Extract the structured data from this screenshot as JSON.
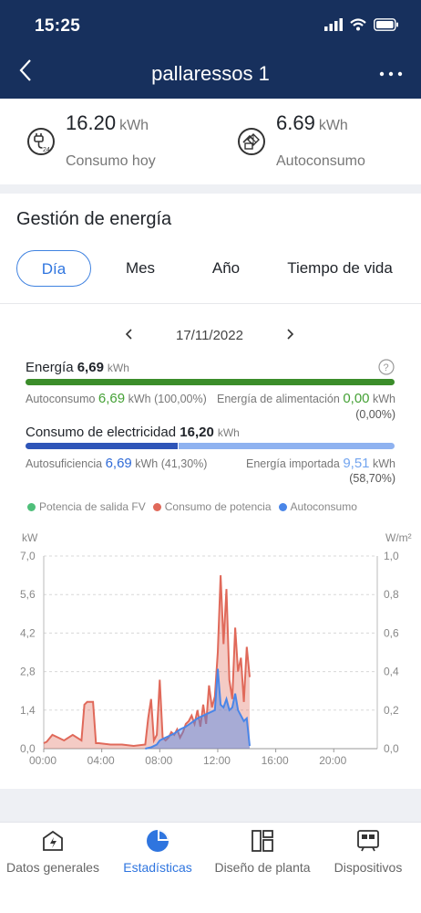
{
  "status_bar": {
    "time": "15:25"
  },
  "header": {
    "title": "pallaressos 1"
  },
  "summary": [
    {
      "icon": "plug-24h-icon",
      "value": "16.20",
      "unit": "kWh",
      "label": "Consumo hoy"
    },
    {
      "icon": "solar-home-icon",
      "value": "6.69",
      "unit": "kWh",
      "label": "Autoconsumo"
    }
  ],
  "panel": {
    "title": "Gestión de energía",
    "tabs": [
      "Día",
      "Mes",
      "Año",
      "Tiempo de vida"
    ],
    "active_tab": "Día",
    "date": "17/11/2022"
  },
  "energy": {
    "label": "Energía",
    "value": "6,69",
    "unit": "kWh",
    "autoconsumo_label": "Autoconsumo",
    "autoconsumo_value": "6,69",
    "autoconsumo_unit": "kWh",
    "autoconsumo_pct": "(100,00%)",
    "alimentacion_label": "Energía de alimentación",
    "alimentacion_value": "0,00",
    "alimentacion_unit": "kWh",
    "alimentacion_pct": "(0,00%)",
    "bar_fraction": 1.0,
    "bar_color": "#3b8d2a"
  },
  "consumo": {
    "label": "Consumo de electricidad",
    "value": "16,20",
    "unit": "kWh",
    "autosuficiencia_label": "Autosuficiencia",
    "autosuficiencia_value": "6,69",
    "autosuficiencia_unit": "kWh",
    "autosuficiencia_pct": "(41,30%)",
    "importada_label": "Energía importada",
    "importada_value": "9,51",
    "importada_unit": "kWh",
    "importada_pct": "(58,70%)",
    "bar_fraction": 0.413,
    "bar_color_left": "#2e55b8",
    "bar_color_right": "#8fb2f0"
  },
  "legend": [
    {
      "label": "Potencia de salida FV",
      "color": "#4fbf7a"
    },
    {
      "label": "Consumo de potencia",
      "color": "#e0695a"
    },
    {
      "label": "Autoconsumo",
      "color": "#4a86e8"
    }
  ],
  "chart_data": {
    "type": "area",
    "y_left_unit": "kW",
    "y_right_unit": "W/m²",
    "ylim": [
      0,
      7
    ],
    "y_left_ticks": [
      "0,0",
      "1,4",
      "2,8",
      "4,2",
      "5,6",
      "7,0"
    ],
    "y_right_ticks": [
      "0,0",
      "0,2",
      "0,4",
      "0,6",
      "0,8",
      "1,0"
    ],
    "x_ticks": [
      "00:00",
      "04:00",
      "08:00",
      "12:00",
      "16:00",
      "20:00"
    ],
    "xlim_hours": [
      0,
      23
    ],
    "grid": true,
    "series": [
      {
        "name": "Consumo de potencia",
        "color": "#e0695a",
        "x": [
          0,
          0.2,
          0.6,
          1.0,
          1.4,
          2.0,
          2.6,
          2.8,
          3.0,
          3.4,
          3.6,
          3.8,
          4.6,
          5.4,
          6.2,
          7.0,
          7.2,
          7.4,
          7.6,
          7.8,
          8.0,
          8.2,
          8.4,
          8.6,
          8.8,
          9.0,
          9.2,
          9.4,
          9.6,
          9.8,
          10.0,
          10.2,
          10.4,
          10.6,
          10.8,
          11.0,
          11.2,
          11.4,
          11.6,
          11.8,
          12.0,
          12.2,
          12.4,
          12.6,
          12.8,
          13.0,
          13.2,
          13.4,
          13.6,
          13.8,
          14.0,
          14.2
        ],
        "values": [
          0.2,
          0.25,
          0.5,
          0.4,
          0.3,
          0.5,
          0.3,
          1.6,
          1.7,
          1.7,
          0.2,
          0.2,
          0.15,
          0.15,
          0.1,
          0.15,
          1.1,
          1.8,
          0.3,
          0.5,
          2.5,
          0.4,
          0.3,
          0.4,
          0.6,
          0.5,
          0.7,
          0.4,
          0.6,
          0.9,
          1.0,
          1.2,
          0.9,
          1.4,
          0.8,
          1.6,
          0.9,
          2.3,
          1.5,
          1.9,
          3.5,
          6.3,
          3.8,
          5.8,
          2.5,
          1.8,
          4.4,
          2.8,
          3.3,
          1.7,
          3.7,
          2.6
        ]
      },
      {
        "name": "Autoconsumo",
        "color": "#4a86e8",
        "x": [
          7.0,
          7.4,
          7.8,
          8.0,
          8.2,
          8.6,
          9.0,
          9.4,
          9.8,
          10.2,
          10.6,
          11.0,
          11.4,
          11.8,
          12.0,
          12.2,
          12.4,
          12.6,
          12.8,
          13.0,
          13.2,
          13.4,
          13.6,
          13.8,
          14.0,
          14.2
        ],
        "values": [
          0,
          0.05,
          0.15,
          0.3,
          0.35,
          0.45,
          0.55,
          0.7,
          0.8,
          0.95,
          1.1,
          1.2,
          1.3,
          1.4,
          2.9,
          1.6,
          1.5,
          1.8,
          1.4,
          1.5,
          2.0,
          1.4,
          1.2,
          1.0,
          1.1,
          0.1
        ]
      }
    ]
  },
  "tabbar": [
    {
      "label": "Datos generales",
      "icon": "dashboard-icon",
      "active": false
    },
    {
      "label": "Estadísticas",
      "icon": "pie-chart-icon",
      "active": true
    },
    {
      "label": "Diseño de planta",
      "icon": "layout-icon",
      "active": false
    },
    {
      "label": "Dispositivos",
      "icon": "devices-icon",
      "active": false
    }
  ]
}
